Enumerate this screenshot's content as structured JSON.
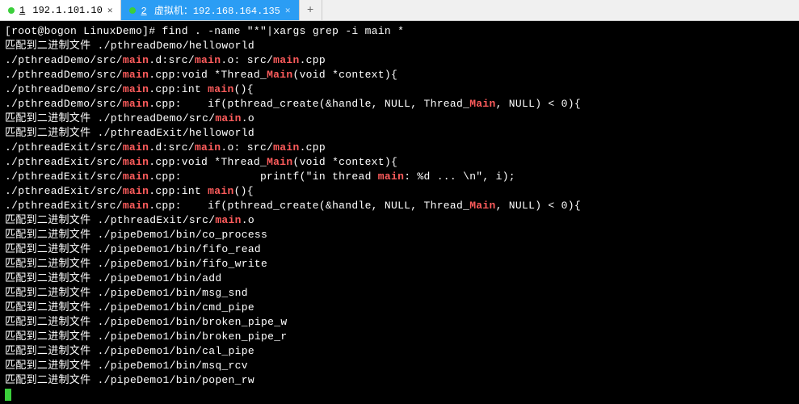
{
  "tabs": [
    {
      "num": "1",
      "label": "192.1.101.10",
      "active": false
    },
    {
      "num": "2",
      "label": "虚拟机：192.168.164.135",
      "active": true
    }
  ],
  "newTabLabel": "+",
  "prompt": {
    "user": "root",
    "host": "bogon",
    "cwd": "LinuxDemo",
    "symbol": "#",
    "command": "find . -name \"*\"|xargs grep -i main *"
  },
  "highlight": "main",
  "lines": [
    "匹配到二进制文件 ./pthreadDemo/helloworld",
    "./pthreadDemo/src/main.d:src/main.o: src/main.cpp",
    "./pthreadDemo/src/main.cpp:void *Thread_Main(void *context){",
    "./pthreadDemo/src/main.cpp:int main(){",
    "./pthreadDemo/src/main.cpp:    if(pthread_create(&handle, NULL, Thread_Main, NULL) < 0){",
    "匹配到二进制文件 ./pthreadDemo/src/main.o",
    "匹配到二进制文件 ./pthreadExit/helloworld",
    "./pthreadExit/src/main.d:src/main.o: src/main.cpp",
    "./pthreadExit/src/main.cpp:void *Thread_Main(void *context){",
    "./pthreadExit/src/main.cpp:            printf(\"in thread main: %d ... \\n\", i);",
    "./pthreadExit/src/main.cpp:int main(){",
    "./pthreadExit/src/main.cpp:    if(pthread_create(&handle, NULL, Thread_Main, NULL) < 0){",
    "匹配到二进制文件 ./pthreadExit/src/main.o",
    "匹配到二进制文件 ./pipeDemo1/bin/co_process",
    "匹配到二进制文件 ./pipeDemo1/bin/fifo_read",
    "匹配到二进制文件 ./pipeDemo1/bin/fifo_write",
    "匹配到二进制文件 ./pipeDemo1/bin/add",
    "匹配到二进制文件 ./pipeDemo1/bin/msg_snd",
    "匹配到二进制文件 ./pipeDemo1/bin/cmd_pipe",
    "匹配到二进制文件 ./pipeDemo1/bin/broken_pipe_w",
    "匹配到二进制文件 ./pipeDemo1/bin/broken_pipe_r",
    "匹配到二进制文件 ./pipeDemo1/bin/cal_pipe",
    "匹配到二进制文件 ./pipeDemo1/bin/msq_rcv",
    "匹配到二进制文件 ./pipeDemo1/bin/popen_rw"
  ]
}
